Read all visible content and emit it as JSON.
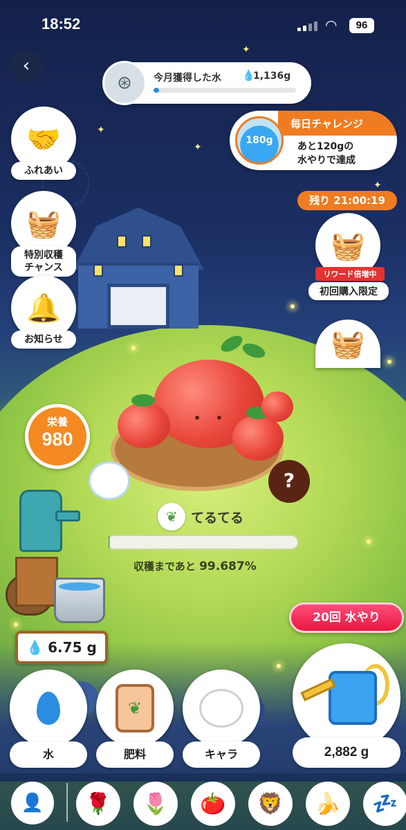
{
  "status_bar": {
    "time": "18:52",
    "battery": "96"
  },
  "header": {
    "monthly_water": {
      "label": "今月獲得した水",
      "value": "1,136g",
      "progress": 0.04
    }
  },
  "daily_challenge": {
    "title": "毎日チャレンジ",
    "jar_value": "180g",
    "desc_line1": "あと120gの",
    "desc_line2": "水やりで達成"
  },
  "timer": {
    "label": "残り 21:00:19"
  },
  "left_menu": [
    {
      "label": "ふれあい",
      "icon": "handshake-icon"
    },
    {
      "label": "特別収穫チャンス",
      "label_line1": "特別収穫",
      "label_line2": "チャンス",
      "icon": "basket-icon"
    },
    {
      "label": "お知らせ",
      "icon": "bell-icon"
    }
  ],
  "right_menu": {
    "offer_tag": "リワード倍増中",
    "offer_label": "初回購入限定"
  },
  "nutrition": {
    "label": "栄養",
    "value": "980"
  },
  "plant": {
    "name": "てるてる",
    "harvest_label": "収穫まであと",
    "harvest_percent": "99.687%",
    "harvest_progress": 0.00313
  },
  "mystery_char": "?",
  "water_owned": {
    "value": "6.75 g"
  },
  "water_x_button": {
    "label": "20回 水やり"
  },
  "watering_can": {
    "value": "2,882 g"
  },
  "actions": [
    {
      "label": "水",
      "icon": "water-drop-icon"
    },
    {
      "label": "肥料",
      "icon": "fertilizer-bag-icon"
    },
    {
      "label": "キャラ",
      "icon": "hamster-icon"
    }
  ],
  "dock": {
    "items": [
      {
        "icon": "rose-icon",
        "glyph": "🌹"
      },
      {
        "icon": "tulip-icon",
        "glyph": "🌷"
      },
      {
        "icon": "tomato-icon",
        "glyph": "🍅"
      },
      {
        "icon": "lion-icon",
        "glyph": "🦁"
      },
      {
        "icon": "banana-icon",
        "glyph": "🍌"
      },
      {
        "icon": "sleeping-creature-icon",
        "glyph": "💤"
      }
    ]
  },
  "colors": {
    "accent_orange": "#f07c21",
    "water_blue": "#2a8de0",
    "reward_red": "#e53232",
    "water_button_pink": "#e8173f"
  }
}
